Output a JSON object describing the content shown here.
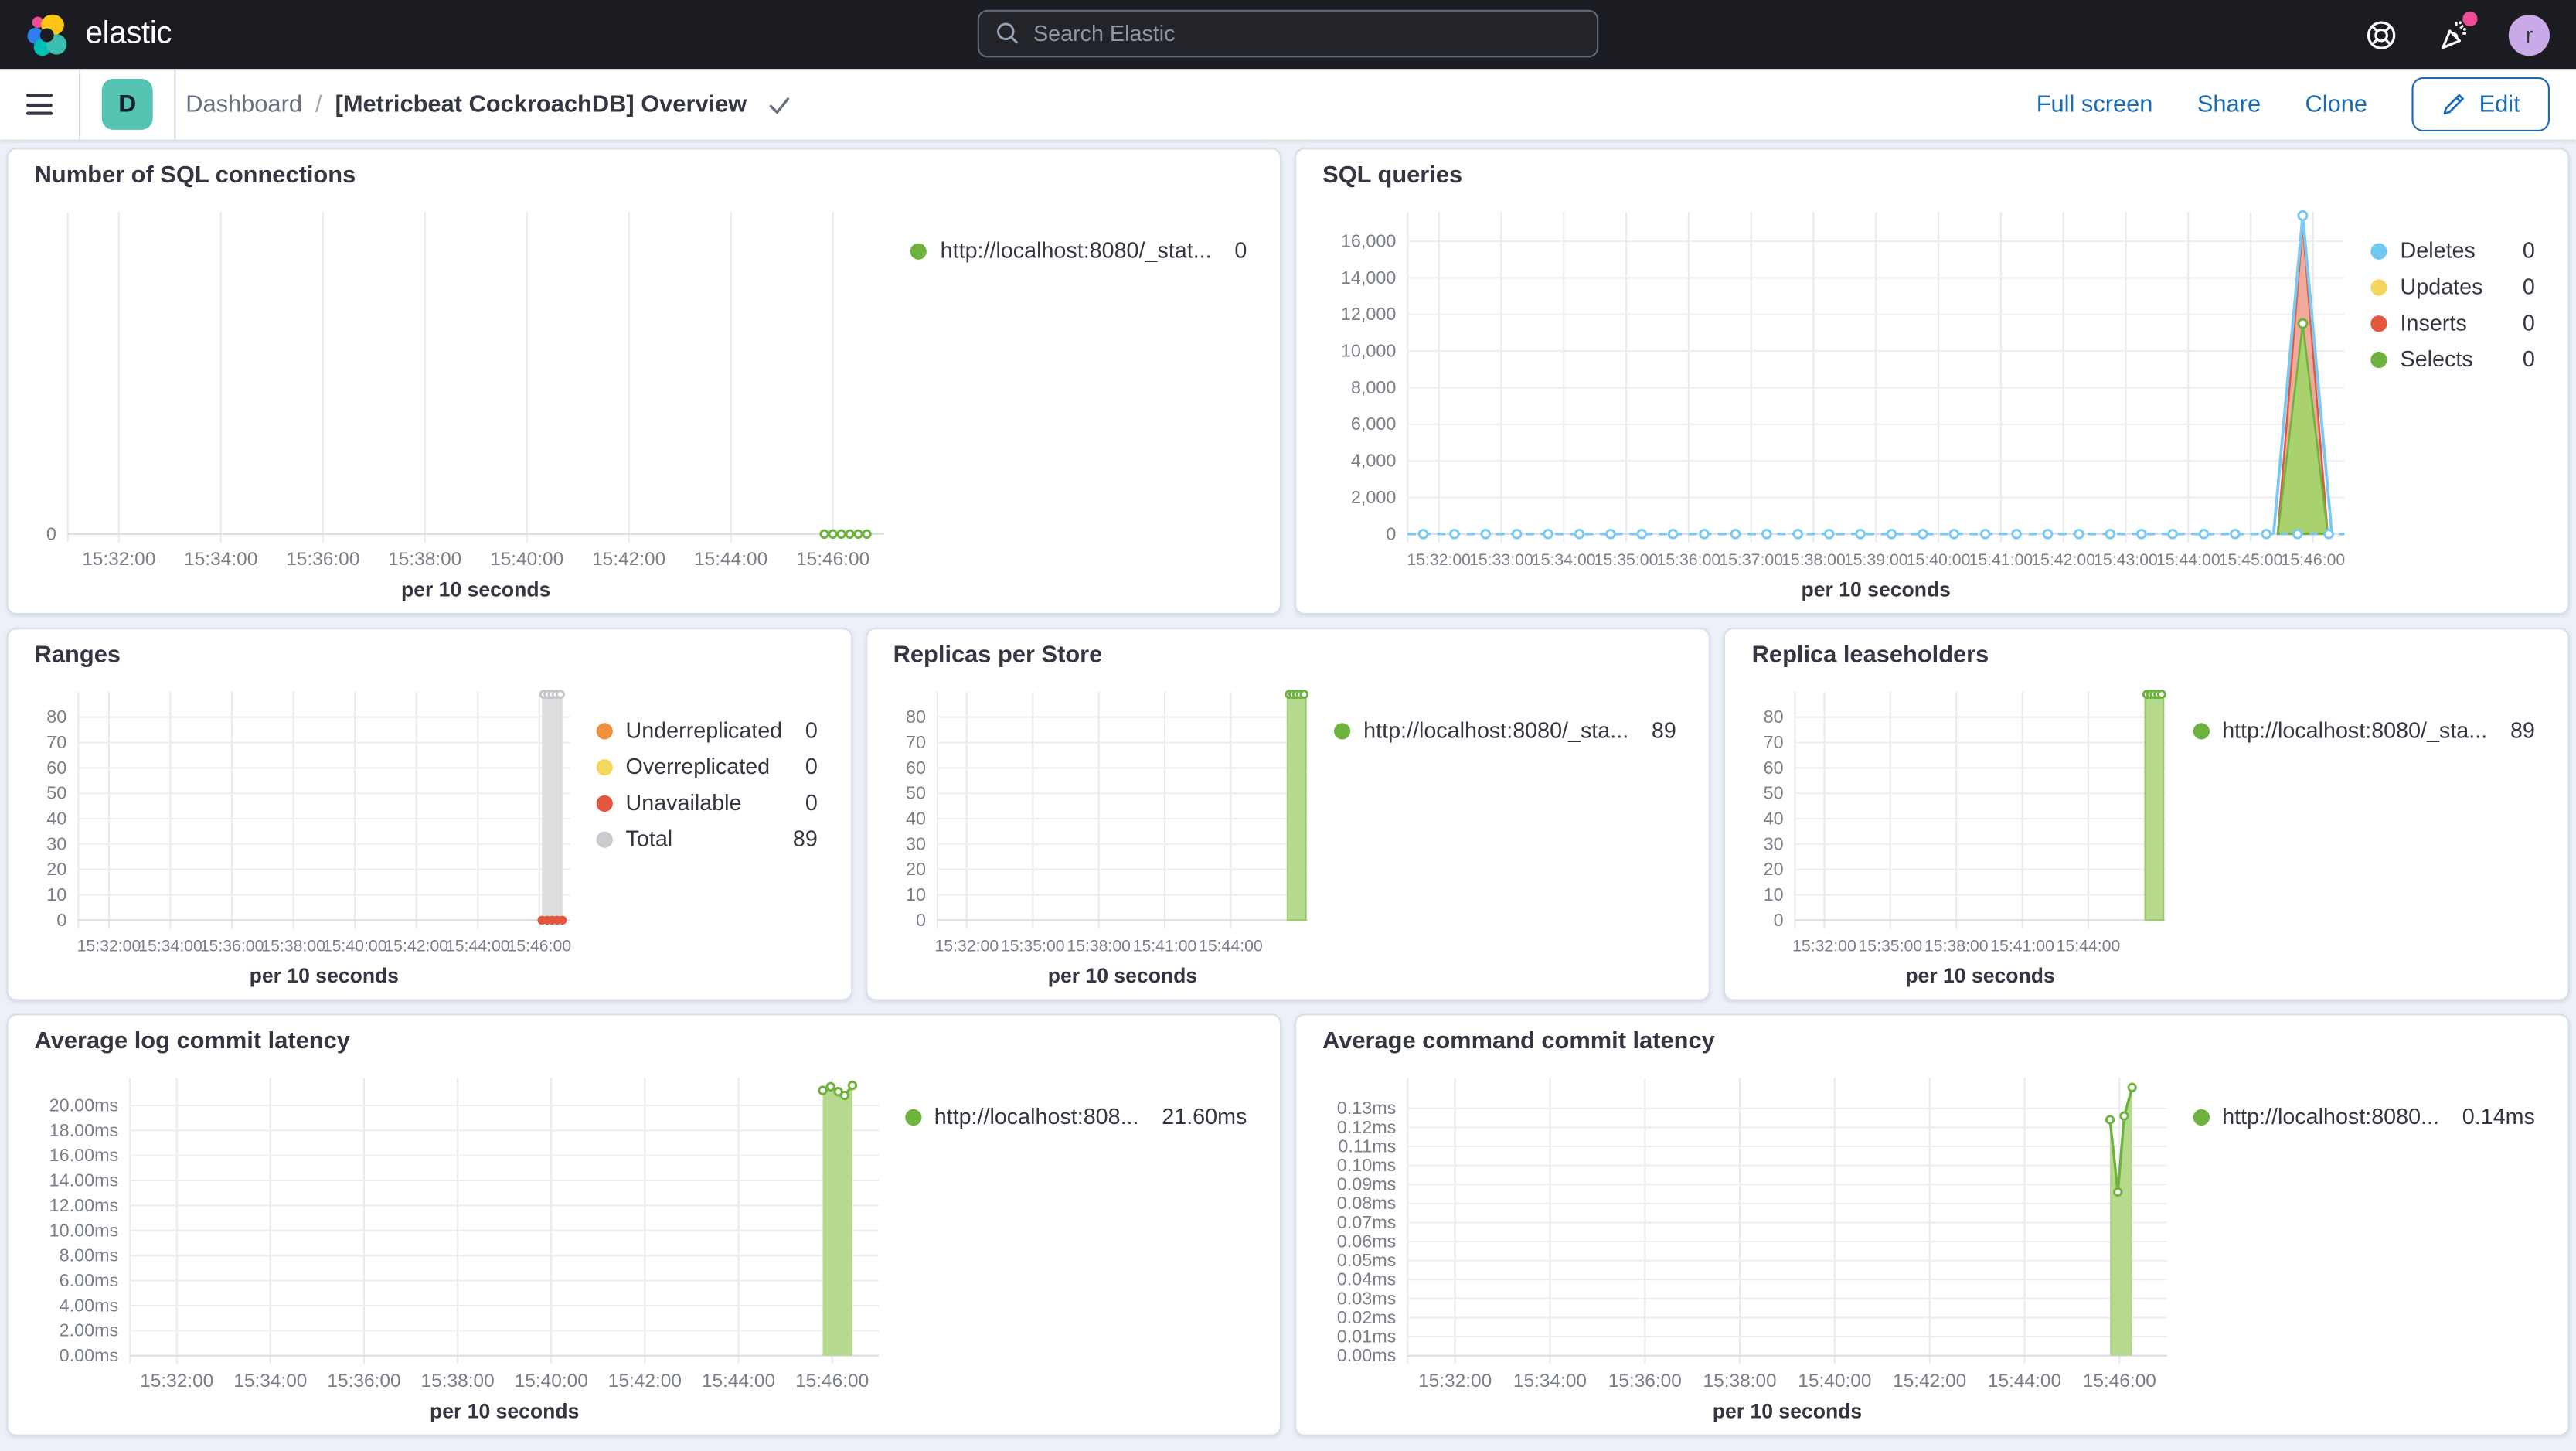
{
  "topbar": {
    "logo_text": "elastic",
    "search_placeholder": "Search Elastic",
    "avatar_letter": "r"
  },
  "navbar": {
    "space_letter": "D",
    "breadcrumb_root": "Dashboard",
    "breadcrumb_separator": "/",
    "title": "[Metricbeat CockroachDB] Overview",
    "action_full_screen": "Full screen",
    "action_share": "Share",
    "action_clone": "Clone",
    "action_edit": "Edit"
  },
  "colors": {
    "topbar_bg": "#1A1C21",
    "page_bg": "#ECF0F7",
    "panel_border": "#D9DFE9",
    "link_blue": "#1C6CB3",
    "title_text": "#343741",
    "axis_text": "#7A7F87",
    "badge_pink": "#F04E98",
    "space_teal": "#54C3B2",
    "avatar_purple": "#C9A9E8",
    "series_green": "#6FB33F",
    "series_green_fill": "#B5D98D",
    "series_blue": "#79C9F3",
    "series_red": "#E4573F",
    "series_yellow": "#F3D65B",
    "series_orange": "#F09140",
    "series_gray": "#DCDDDF"
  },
  "chart_data": [
    {
      "id": "number-of-sql-connections",
      "type": "line",
      "title": "Number of SQL connections",
      "xlabel": "per 10 seconds",
      "x_domain": [
        "15:31:00",
        "15:47:00"
      ],
      "xticks": [
        "15:32:00",
        "15:34:00",
        "15:36:00",
        "15:38:00",
        "15:40:00",
        "15:42:00",
        "15:44:00",
        "15:46:00"
      ],
      "ylim": [
        0,
        1
      ],
      "yticks": {
        "values": [
          0
        ],
        "labels": [
          "0"
        ]
      },
      "series": [
        {
          "name": "http://localhost:8080/_stat...",
          "legend_value": "0",
          "color": "#6FB33F",
          "type": "line",
          "points": [
            [
              "15:45:50",
              0
            ],
            [
              "15:46:00",
              0
            ],
            [
              "15:46:10",
              0
            ],
            [
              "15:46:20",
              0
            ],
            [
              "15:46:30",
              0
            ],
            [
              "15:46:40",
              0
            ]
          ]
        }
      ]
    },
    {
      "id": "sql-queries",
      "type": "area",
      "title": "SQL queries",
      "xlabel": "per 10 seconds",
      "x_domain": [
        "15:31:30",
        "15:46:30"
      ],
      "xticks": [
        "15:32:00",
        "15:33:00",
        "15:34:00",
        "15:35:00",
        "15:36:00",
        "15:37:00",
        "15:38:00",
        "15:39:00",
        "15:40:00",
        "15:41:00",
        "15:42:00",
        "15:43:00",
        "15:44:00",
        "15:45:00",
        "15:46:00"
      ],
      "ylim": [
        0,
        17600
      ],
      "yticks": {
        "values": [
          0,
          2000,
          4000,
          6000,
          8000,
          10000,
          12000,
          14000,
          16000
        ],
        "labels": [
          "0",
          "2,000",
          "4,000",
          "6,000",
          "8,000",
          "10,000",
          "12,000",
          "14,000",
          "16,000"
        ]
      },
      "series": [
        {
          "name": "Deletes",
          "legend_value": "0",
          "color": "#79C9F3",
          "dot_color": "#6FC8F0",
          "type": "dashline",
          "marker_step_sec": 30,
          "draw_order": 4,
          "peak_marker": true,
          "spike": [
            [
              "15:45:22",
              0
            ],
            [
              "15:45:50",
              17400
            ],
            [
              "15:46:18",
              0
            ]
          ]
        },
        {
          "name": "Updates",
          "legend_value": "0",
          "color": "#F3D65B",
          "type": "line",
          "points": [],
          "draw_order": 1
        },
        {
          "name": "Inserts",
          "legend_value": "0",
          "color": "#E4573F",
          "type": "spike",
          "fill": "#F0A191",
          "opacity": 0.9,
          "draw_order": 2,
          "points": [
            [
              "15:45:26",
              0
            ],
            [
              "15:45:50",
              16900
            ],
            [
              "15:46:14",
              0
            ]
          ]
        },
        {
          "name": "Selects",
          "legend_value": "0",
          "color": "#6FB33F",
          "type": "spike",
          "fill": "#A9D16D",
          "opacity": 1,
          "peak_marker": true,
          "draw_order": 3,
          "points": [
            [
              "15:45:26",
              0
            ],
            [
              "15:45:50",
              11500
            ],
            [
              "15:46:14",
              0
            ]
          ]
        }
      ]
    },
    {
      "id": "ranges",
      "type": "bar",
      "title": "Ranges",
      "xlabel": "per 10 seconds",
      "x_domain": [
        "15:31:00",
        "15:47:00"
      ],
      "xticks": [
        "15:32:00",
        "15:34:00",
        "15:36:00",
        "15:38:00",
        "15:40:00",
        "15:42:00",
        "15:44:00",
        "15:46:00"
      ],
      "ylim": [
        0,
        90
      ],
      "yticks": {
        "values": [
          0,
          10,
          20,
          30,
          40,
          50,
          60,
          70,
          80
        ],
        "labels": [
          "0",
          "10",
          "20",
          "30",
          "40",
          "50",
          "60",
          "70",
          "80"
        ]
      },
      "series": [
        {
          "name": "Underreplicated",
          "legend_value": "0",
          "color": "#F09140",
          "type": "line",
          "points": []
        },
        {
          "name": "Overreplicated",
          "legend_value": "0",
          "color": "#F2D95C",
          "type": "line",
          "points": []
        },
        {
          "name": "Unavailable",
          "legend_value": "0",
          "color": "#E4573F",
          "type": "dots",
          "draw_order": 2,
          "points": [
            [
              "15:46:05",
              0
            ],
            [
              "15:46:15",
              0
            ],
            [
              "15:46:25",
              0
            ],
            [
              "15:46:35",
              0
            ],
            [
              "15:46:45",
              0
            ]
          ]
        },
        {
          "name": "Total",
          "legend_value": "89",
          "color": "#DCDDDF",
          "dot_color": "#C9CCD0",
          "type": "bar",
          "from": "15:46:05",
          "to": "15:46:45",
          "value": 89,
          "top_markers": 5,
          "marker_color": "#C4C6CA",
          "draw_order": 1
        }
      ]
    },
    {
      "id": "replicas-per-store",
      "type": "bar",
      "title": "Replicas per Store",
      "xlabel": "per 10 seconds",
      "x_domain": [
        "15:30:40",
        "15:47:30"
      ],
      "xticks": [
        "15:32:00",
        "15:35:00",
        "15:38:00",
        "15:41:00",
        "15:44:00"
      ],
      "ylim": [
        0,
        90
      ],
      "yticks": {
        "values": [
          0,
          10,
          20,
          30,
          40,
          50,
          60,
          70,
          80
        ],
        "labels": [
          "0",
          "10",
          "20",
          "30",
          "40",
          "50",
          "60",
          "70",
          "80"
        ]
      },
      "series": [
        {
          "name": "http://localhost:8080/_sta...",
          "legend_value": "89",
          "color": "#B5D98D",
          "dot_color": "#6FB33F",
          "stroke": "#9CC86B",
          "type": "bar",
          "from": "15:46:35",
          "to": "15:47:25",
          "value": 89,
          "top_markers": 5,
          "marker_color": "#6FB33F"
        }
      ]
    },
    {
      "id": "replica-leaseholders",
      "type": "bar",
      "title": "Replica leaseholders",
      "xlabel": "per 10 seconds",
      "x_domain": [
        "15:30:40",
        "15:47:30"
      ],
      "xticks": [
        "15:32:00",
        "15:35:00",
        "15:38:00",
        "15:41:00",
        "15:44:00"
      ],
      "ylim": [
        0,
        90
      ],
      "yticks": {
        "values": [
          0,
          10,
          20,
          30,
          40,
          50,
          60,
          70,
          80
        ],
        "labels": [
          "0",
          "10",
          "20",
          "30",
          "40",
          "50",
          "60",
          "70",
          "80"
        ]
      },
      "series": [
        {
          "name": "http://localhost:8080/_sta...",
          "legend_value": "89",
          "color": "#B5D98D",
          "dot_color": "#6FB33F",
          "stroke": "#9CC86B",
          "type": "bar",
          "from": "15:46:35",
          "to": "15:47:25",
          "value": 89,
          "top_markers": 5,
          "marker_color": "#6FB33F"
        }
      ]
    },
    {
      "id": "average-log-commit-latency",
      "type": "area",
      "title": "Average log commit latency",
      "xlabel": "per 10 seconds",
      "x_domain": [
        "15:31:00",
        "15:47:00"
      ],
      "xticks": [
        "15:32:00",
        "15:34:00",
        "15:36:00",
        "15:38:00",
        "15:40:00",
        "15:42:00",
        "15:44:00",
        "15:46:00"
      ],
      "ylim": [
        0,
        22.2
      ],
      "yticks": {
        "values": [
          0,
          2,
          4,
          6,
          8,
          10,
          12,
          14,
          16,
          18,
          20
        ],
        "labels": [
          "0.00ms",
          "2.00ms",
          "4.00ms",
          "6.00ms",
          "8.00ms",
          "10.00ms",
          "12.00ms",
          "14.00ms",
          "16.00ms",
          "18.00ms",
          "20.00ms"
        ]
      },
      "series": [
        {
          "name": "http://localhost:808...",
          "legend_value": "21.60ms",
          "color": "#6FB33F",
          "fill": "#B5D98D",
          "type": "area",
          "points": [
            [
              "15:45:48",
              21.2
            ],
            [
              "15:45:58",
              21.5
            ],
            [
              "15:46:08",
              21.1
            ],
            [
              "15:46:16",
              20.8
            ],
            [
              "15:46:26",
              21.6
            ]
          ]
        }
      ]
    },
    {
      "id": "average-command-commit-latency",
      "type": "area",
      "title": "Average command commit latency",
      "xlabel": "per 10 seconds",
      "x_domain": [
        "15:31:00",
        "15:47:00"
      ],
      "xticks": [
        "15:32:00",
        "15:34:00",
        "15:36:00",
        "15:38:00",
        "15:40:00",
        "15:42:00",
        "15:44:00",
        "15:46:00"
      ],
      "ylim": [
        0,
        0.146
      ],
      "yticks": {
        "values": [
          0,
          0.01,
          0.02,
          0.03,
          0.04,
          0.05,
          0.06,
          0.07,
          0.08,
          0.09,
          0.1,
          0.11,
          0.12,
          0.13
        ],
        "labels": [
          "0.00ms",
          "0.01ms",
          "0.02ms",
          "0.03ms",
          "0.04ms",
          "0.05ms",
          "0.06ms",
          "0.07ms",
          "0.08ms",
          "0.09ms",
          "0.10ms",
          "0.11ms",
          "0.12ms",
          "0.13ms"
        ]
      },
      "series": [
        {
          "name": "http://localhost:8080...",
          "legend_value": "0.14ms",
          "color": "#6FB33F",
          "fill": "#B5D98D",
          "type": "area",
          "points": [
            [
              "15:45:48",
              0.124
            ],
            [
              "15:45:58",
              0.086
            ],
            [
              "15:46:06",
              0.126
            ],
            [
              "15:46:16",
              0.141
            ]
          ]
        }
      ]
    }
  ]
}
